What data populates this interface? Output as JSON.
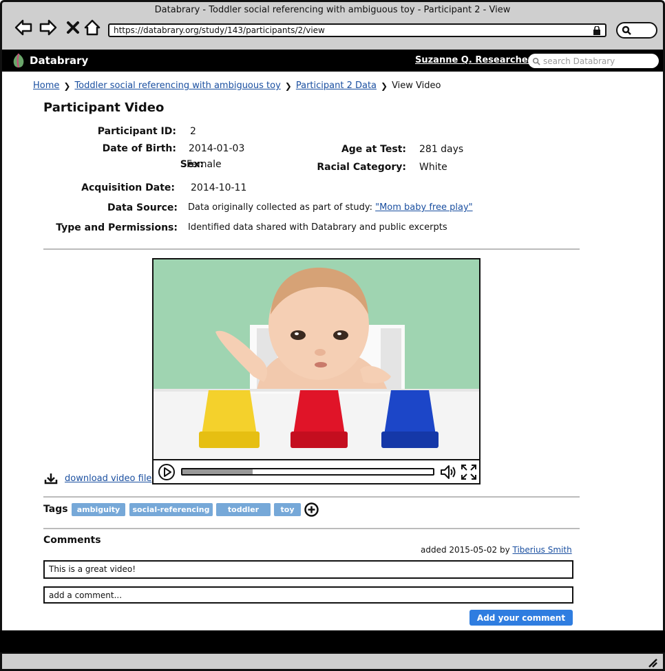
{
  "browser": {
    "window_title": "Databrary - Toddler social referencing with ambiguous toy - Participant 2 - View",
    "url": "https://databrary.org/study/143/participants/2/view"
  },
  "app": {
    "name": "Databrary",
    "user": "Suzanne Q. Researcher",
    "search_placeholder": "search Databrary"
  },
  "breadcrumb": {
    "home": "Home",
    "study": "Toddler social referencing with ambiguous toy",
    "participant": "Participant 2 Data",
    "current": "View Video"
  },
  "page_title": "Participant Video",
  "participant": {
    "id_label": "Participant ID:",
    "id": "2",
    "dob_label": "Date of Birth:",
    "dob": "2014-01-03",
    "sex_label": "Sex:",
    "sex": "Female",
    "age_label": "Age at Test:",
    "age": "281 days",
    "race_label": "Racial Category:",
    "race": "White",
    "acq_label": "Acquisition Date:",
    "acq": "2014-10-11",
    "source_label": "Data Source:",
    "source_text": "Data originally collected as part of study:",
    "source_link": "\"Mom baby free play\"",
    "perm_label": "Type and Permissions:",
    "perm": "Identified data shared with Databrary and public excerpts"
  },
  "video": {
    "progress": 0.28,
    "cup_colors": [
      "#f4d12c",
      "#e01428",
      "#1c46c8"
    ]
  },
  "download_label": "download video file",
  "tags": {
    "label": "Tags",
    "items": [
      "ambiguity",
      "social-referencing",
      "toddler",
      "toy"
    ]
  },
  "comments": {
    "label": "Comments",
    "meta_prefix": "added 2015-05-02  by",
    "author": "Tiberius Smith",
    "text": "This is a great video!",
    "input_placeholder": "add a comment...",
    "submit_label": "Add your comment"
  }
}
